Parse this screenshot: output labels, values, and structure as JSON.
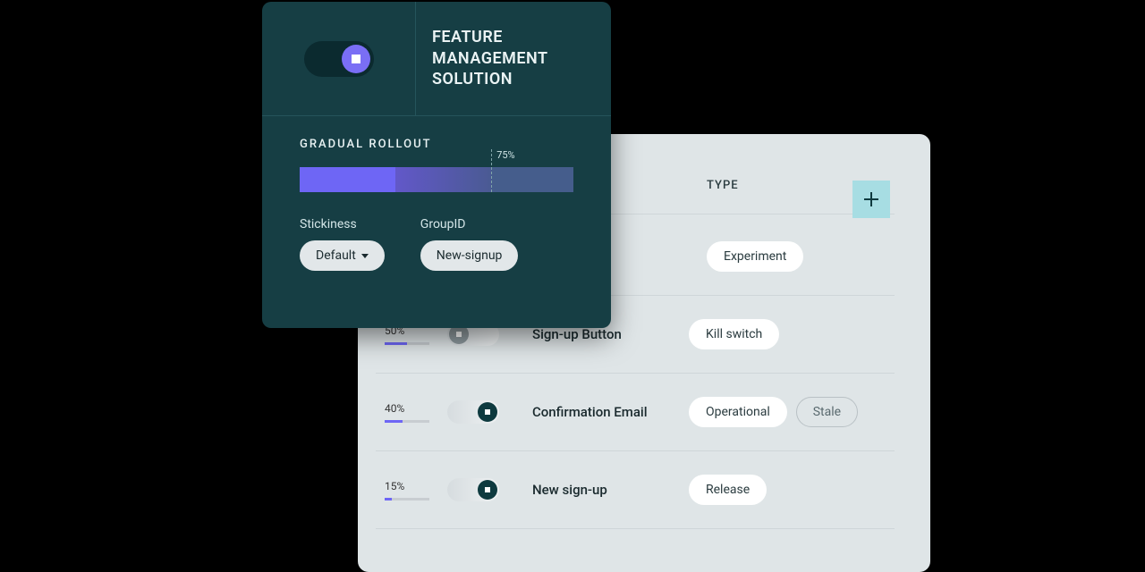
{
  "darkCard": {
    "title": "FEATURE MANAGEMENT SOLUTION",
    "rolloutLabel": "GRADUAL ROLLOUT",
    "rolloutPercent": "75%",
    "fields": {
      "stickiness": {
        "label": "Stickiness",
        "value": "Default"
      },
      "groupId": {
        "label": "GroupID",
        "value": "New-signup"
      }
    }
  },
  "featureCard": {
    "header": {
      "type": "TYPE"
    },
    "rows": [
      {
        "percent": "",
        "fill": 0,
        "toggle": "",
        "name": "",
        "tags": [
          {
            "text": "Experiment",
            "style": "solid"
          }
        ]
      },
      {
        "percent": "50%",
        "fill": 50,
        "toggle": "off",
        "name": "Sign-up Button",
        "tags": [
          {
            "text": "Kill switch",
            "style": "solid"
          }
        ]
      },
      {
        "percent": "40%",
        "fill": 40,
        "toggle": "on",
        "name": "Confirmation Email",
        "tags": [
          {
            "text": "Operational",
            "style": "solid"
          },
          {
            "text": "Stale",
            "style": "outline"
          }
        ]
      },
      {
        "percent": "15%",
        "fill": 15,
        "toggle": "on",
        "name": "New sign-up",
        "tags": [
          {
            "text": "Release",
            "style": "solid"
          }
        ]
      }
    ]
  }
}
